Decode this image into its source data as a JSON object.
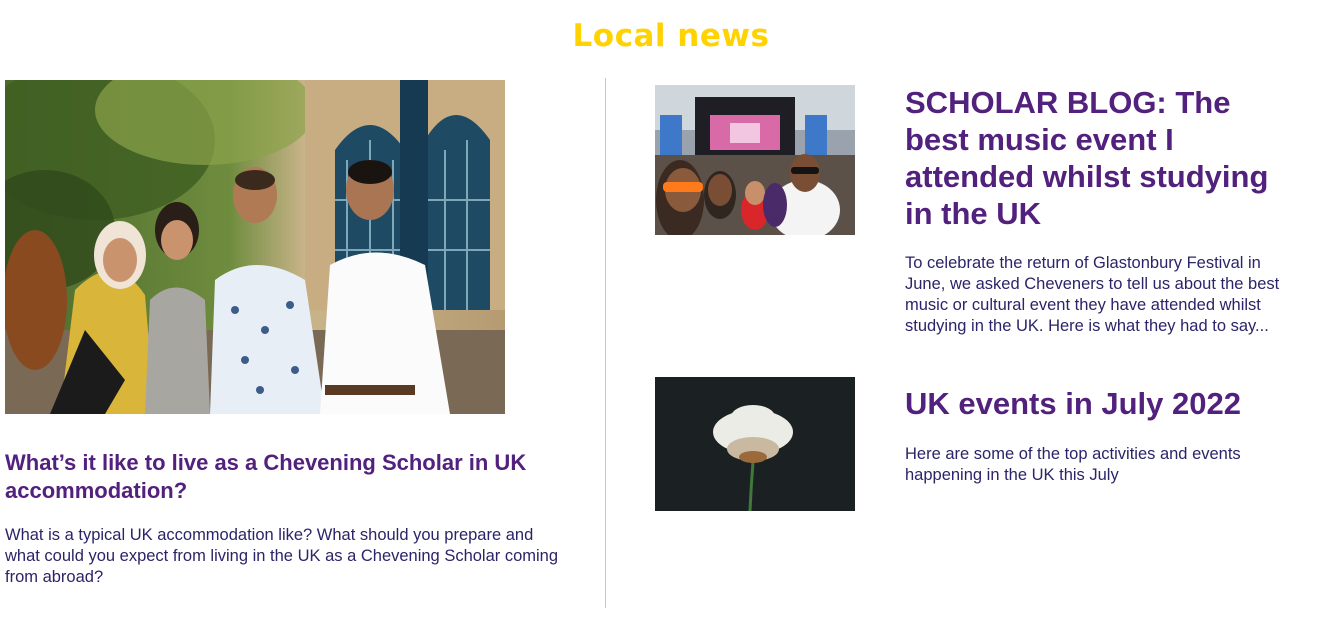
{
  "section": {
    "title": "Local news",
    "title_color": "#ffd200",
    "heading_color": "#52207d",
    "text_color": "#2b2468"
  },
  "feature": {
    "image_icon": "photo-group-of-scholars",
    "title": "What’s it like to live as a Chevening Scholar in UK accommodation?",
    "description": "What is a typical UK accommodation like? What should you prepare and what could you expect from living in the UK as a Chevening Scholar coming from abroad?"
  },
  "cards": [
    {
      "image_icon": "photo-festival-selfie",
      "title": "SCHOLAR BLOG: The best music event I attended whilst studying in the UK",
      "description": "To celebrate the return of Glastonbury Festival in June, we asked Cheveners to tell us about the best music or cultural event they have attended whilst studying in the UK. Here is what they had to say..."
    },
    {
      "image_icon": "photo-clover-flower",
      "title": "UK events in July 2022",
      "description": "Here are some of the top activities and events happening in the UK this July"
    }
  ]
}
